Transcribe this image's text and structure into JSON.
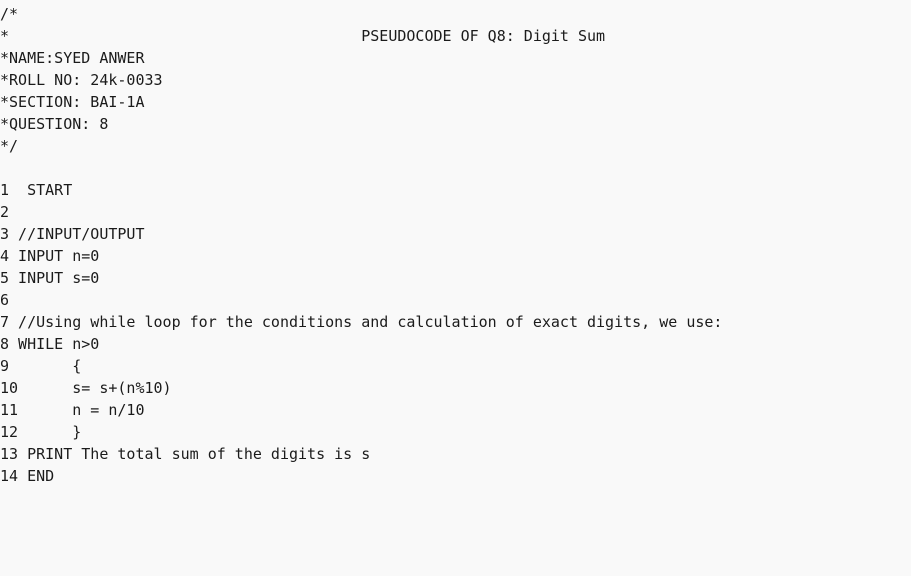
{
  "document": {
    "lines": [
      "/*",
      "*                                       PSEUDOCODE OF Q8: Digit Sum",
      "*NAME:SYED ANWER",
      "*ROLL NO: 24k-0033",
      "*SECTION: BAI-1A",
      "*QUESTION: 8",
      "*/",
      "",
      "1  START",
      "2",
      "3 //INPUT/OUTPUT",
      "4 INPUT n=0",
      "5 INPUT s=0",
      "6",
      "7 //Using while loop for the conditions and calculation of exact digits, we use:",
      "8 WHILE n>0",
      "9       {",
      "10      s= s+(n%10)",
      "11      n = n/10",
      "12      }",
      "13 PRINT The total sum of the digits is s",
      "14 END"
    ]
  }
}
